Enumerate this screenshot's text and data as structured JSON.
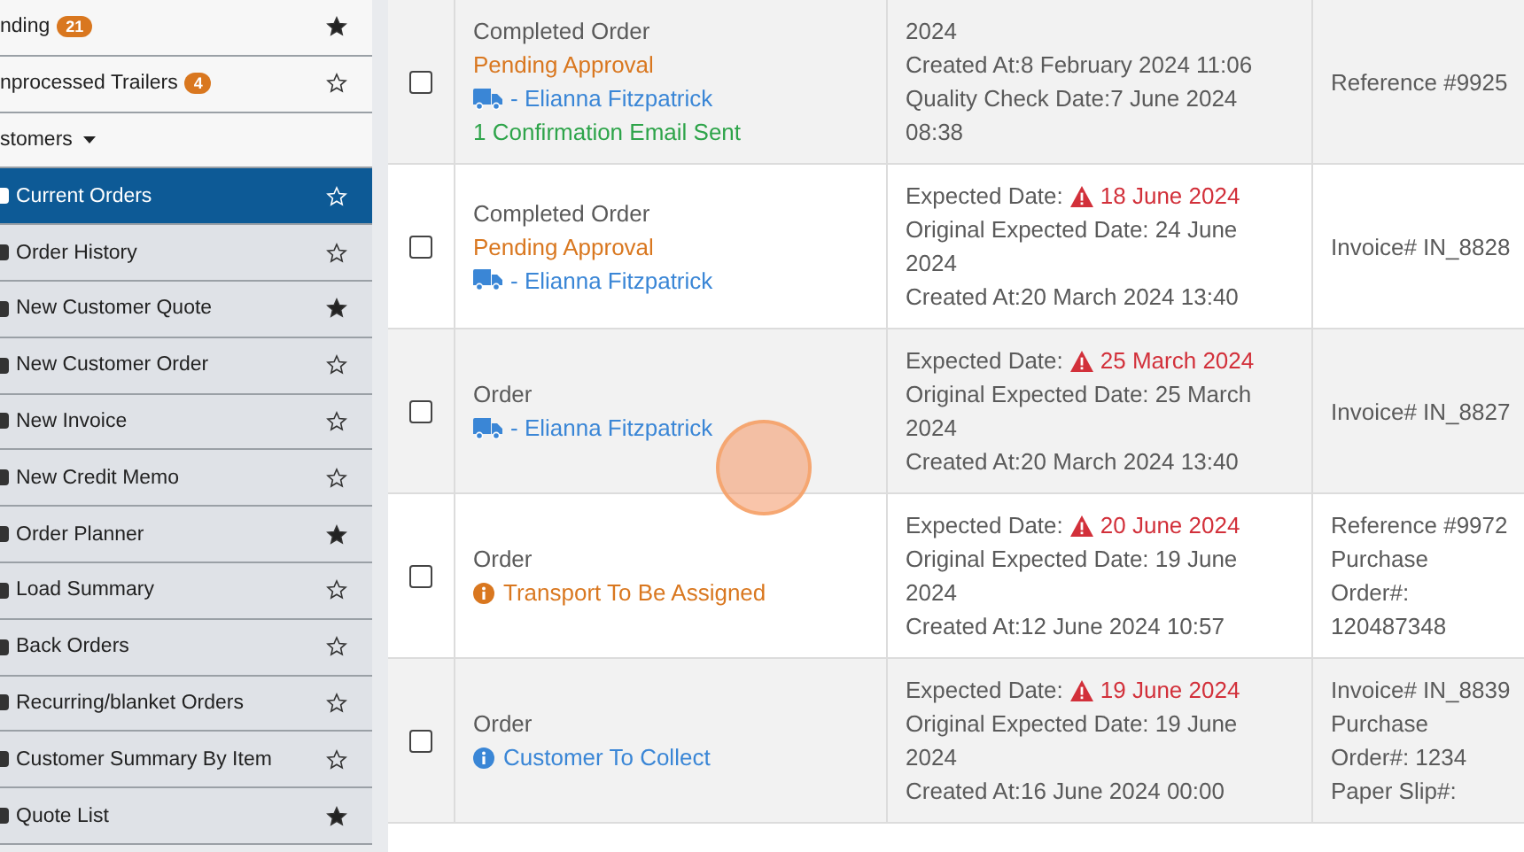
{
  "sidebar": {
    "items": [
      {
        "label": "nding",
        "badge": "21",
        "starred": true,
        "kind": "top",
        "selected": false
      },
      {
        "label": "nprocessed Trailers",
        "badge": "4",
        "starred": false,
        "kind": "top",
        "selected": false
      },
      {
        "label": "stomers",
        "kind": "header",
        "expanded": true
      },
      {
        "label": "Current Orders",
        "starred": false,
        "kind": "sub",
        "selected": true
      },
      {
        "label": "Order History",
        "starred": false,
        "kind": "sub",
        "selected": false
      },
      {
        "label": "New Customer Quote",
        "starred": true,
        "kind": "sub",
        "selected": false
      },
      {
        "label": "New Customer Order",
        "starred": false,
        "kind": "sub",
        "selected": false
      },
      {
        "label": "New Invoice",
        "starred": false,
        "kind": "sub",
        "selected": false
      },
      {
        "label": "New Credit Memo",
        "starred": false,
        "kind": "sub",
        "selected": false
      },
      {
        "label": "Order Planner",
        "starred": true,
        "kind": "sub",
        "selected": false
      },
      {
        "label": "Load Summary",
        "starred": false,
        "kind": "sub",
        "selected": false
      },
      {
        "label": "Back Orders",
        "starred": false,
        "kind": "sub",
        "selected": false
      },
      {
        "label": "Recurring/blanket Orders",
        "starred": false,
        "kind": "sub",
        "selected": false
      },
      {
        "label": "Customer Summary By Item",
        "starred": false,
        "kind": "sub",
        "selected": false
      },
      {
        "label": "Quote List",
        "starred": true,
        "kind": "sub",
        "selected": false
      }
    ]
  },
  "table": {
    "rows": [
      {
        "checked": false,
        "type": "Completed Order",
        "status": {
          "text": "Pending Approval",
          "color": "#d9771f",
          "info_icon": false
        },
        "driver": "- Elianna Fitzpatrick",
        "note": "1 Confirmation Email Sent",
        "dates": [
          {
            "text": "2024"
          },
          {
            "text": "Created At:8 February 2024 11:06"
          },
          {
            "text": "Quality Check Date:7 June 2024 08:38"
          }
        ],
        "refs": [
          "Reference #9925"
        ]
      },
      {
        "checked": false,
        "type": "Completed Order",
        "status": {
          "text": "Pending Approval",
          "color": "#d9771f",
          "info_icon": false
        },
        "driver": "- Elianna Fitzpatrick",
        "dates": [
          {
            "text": "Expected Date:",
            "value": "18 June 2024",
            "overdue": true
          },
          {
            "text": "Original Expected Date: 24 June 2024"
          },
          {
            "text": "Created At:20 March 2024 13:40"
          }
        ],
        "refs": [
          "Invoice# IN_8828"
        ]
      },
      {
        "checked": false,
        "type": "Order",
        "driver": "- Elianna Fitzpatrick",
        "dates": [
          {
            "text": "Expected Date:",
            "value": "25 March 2024",
            "overdue": true
          },
          {
            "text": "Original Expected Date: 25 March 2024"
          },
          {
            "text": "Created At:20 March 2024 13:40"
          }
        ],
        "refs": [
          "Invoice# IN_8827"
        ]
      },
      {
        "checked": false,
        "type": "Order",
        "status": {
          "text": "Transport To Be Assigned",
          "color": "#d9771f",
          "info_icon": true
        },
        "dates": [
          {
            "text": "Expected Date:",
            "value": "20 June 2024",
            "overdue": true
          },
          {
            "text": "Original Expected Date: 19 June 2024"
          },
          {
            "text": "Created At:12 June 2024 10:57"
          }
        ],
        "refs": [
          "Reference #9972",
          "Purchase Order#: 120487348"
        ]
      },
      {
        "checked": false,
        "type": "Order",
        "status": {
          "text": "Customer To Collect",
          "color": "#3a86d6",
          "info_icon": true
        },
        "dates": [
          {
            "text": "Expected Date:",
            "value": "19 June 2024",
            "overdue": true
          },
          {
            "text": "Original Expected Date: 19 June 2024"
          },
          {
            "text": "Created At:16 June 2024 00:00"
          }
        ],
        "refs": [
          "Invoice# IN_8839",
          "Purchase Order#: 1234",
          "Paper Slip#:"
        ]
      }
    ]
  }
}
